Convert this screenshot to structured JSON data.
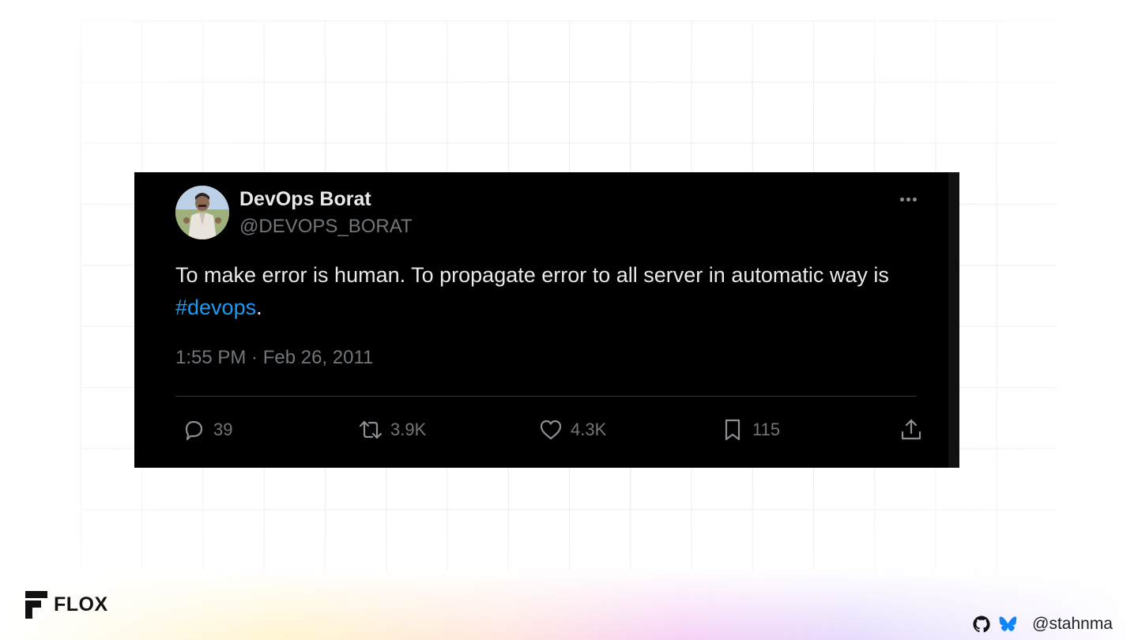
{
  "tweet": {
    "display_name": "DevOps Borat",
    "handle": "@DEVOPS_BORAT",
    "text_before": "To make error is human. To propagate error to all server in automatic way is ",
    "hashtag": "#devops",
    "text_after": ".",
    "timestamp": "1:55 PM · Feb 26, 2011",
    "stats": {
      "replies": "39",
      "retweets": "3.9K",
      "likes": "4.3K",
      "bookmarks": "115"
    },
    "hashtag_color": "#1d9bf0",
    "background": "#000000"
  },
  "footer": {
    "logo_text": "FLOX",
    "social_handle": "@stahnma"
  },
  "icons": [
    "avatar",
    "more-icon",
    "reply-icon",
    "retweet-icon",
    "like-icon",
    "bookmark-icon",
    "share-icon",
    "flox-logo-icon",
    "github-icon",
    "bluesky-icon"
  ]
}
